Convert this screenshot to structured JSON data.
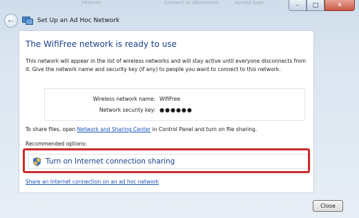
{
  "background_titles": [
    "Internet",
    "Connect or disconnect",
    "Access type:"
  ],
  "window": {
    "title": "Set Up an Ad Hoc Network",
    "buttons": {
      "minimize": "–",
      "maximize": "□",
      "close": "✕"
    }
  },
  "main": {
    "heading": "The WifiFree network is ready to use",
    "description": "This network will appear in the list of wireless networks and will stay active until everyone disconnects from it. Give the network name and security key (if any) to people you want to connect to this network.",
    "network_name_label": "Wireless network name:",
    "network_name_value": "WifiFree",
    "security_key_label": "Network security key:",
    "security_key_value": "●●●●●●",
    "share_prefix": "To share files, open ",
    "share_link": "Network and Sharing Center",
    "share_suffix": " in Control Panel and turn on file sharing.",
    "recommended_label": "Recommended options:",
    "command_link": "Turn on Internet connection sharing",
    "bottom_link": "Share an Internet connection on an ad hoc network"
  },
  "footer": {
    "close_label": "Close"
  },
  "colors": {
    "heading": "#1e3f8a",
    "link": "#1552b5",
    "highlight": "#cc2a2a"
  }
}
